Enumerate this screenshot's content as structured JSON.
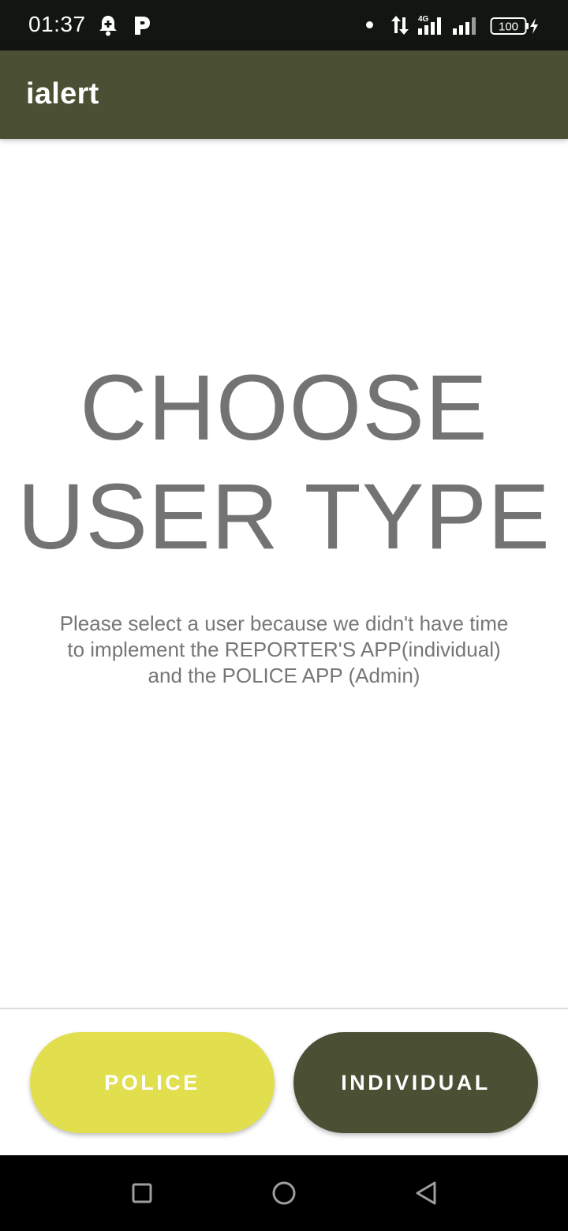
{
  "status_bar": {
    "time": "01:37",
    "icons": [
      "notification-bell-icon",
      "parking-app-icon",
      "dot-icon",
      "data-arrows-icon",
      "signal-4g-icon",
      "signal-icon",
      "battery-icon",
      "charging-icon"
    ],
    "network_label": "4G",
    "battery_level": "100"
  },
  "app_bar": {
    "title": "ialert"
  },
  "main": {
    "headline_line1": "CHOOSE",
    "headline_line2": "USER TYPE",
    "description_line1": "Please select a user because we didn't have time",
    "description_line2": "to implement the REPORTER'S APP(individual)",
    "description_line3": "and the POLICE APP (Admin)"
  },
  "actions": {
    "police_label": "POLICE",
    "individual_label": "INDIVIDUAL"
  },
  "nav_bar": {
    "icons": [
      "recents-icon",
      "home-icon",
      "back-icon"
    ]
  },
  "colors": {
    "app_bar": "#4b5034",
    "police_button": "#e2df4f",
    "individual_button": "#4b5034",
    "headline_text": "#737373",
    "status_bar": "#111611"
  }
}
